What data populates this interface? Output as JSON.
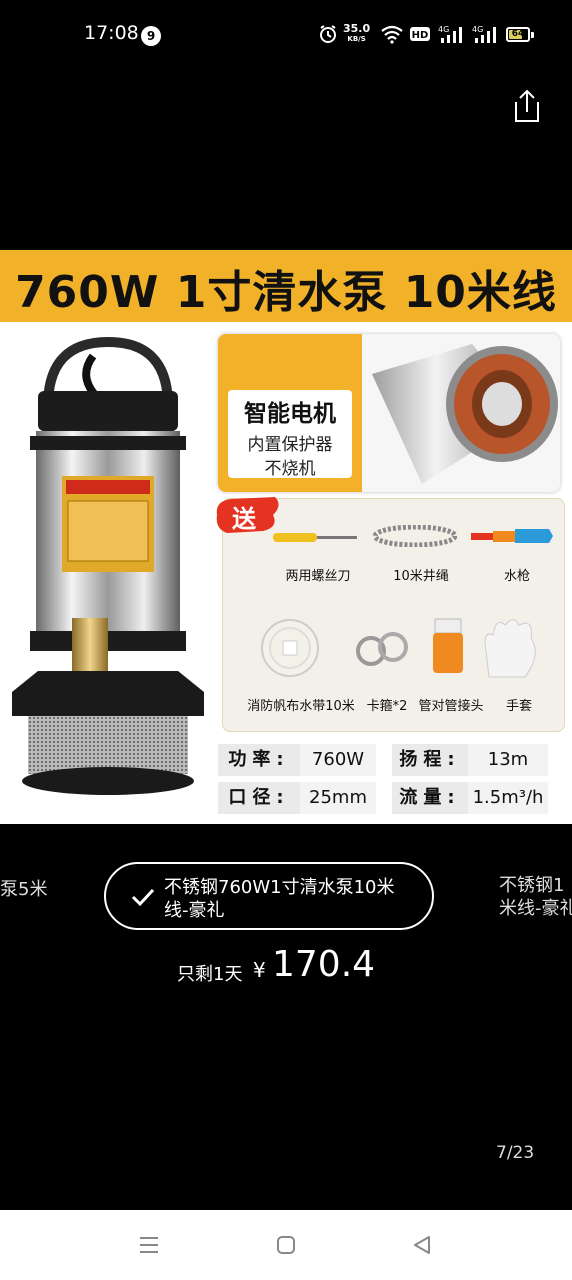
{
  "status_bar": {
    "time": "17:08",
    "notification_count": "9",
    "net_speed_value": "35.0",
    "net_speed_unit": "KB/S",
    "battery_level": "64",
    "icons": [
      "alarm-icon",
      "wifi-icon",
      "hd-icon",
      "signal-4g-icon",
      "signal-4g-icon",
      "battery-icon"
    ]
  },
  "header": {
    "share_icon": "share-icon"
  },
  "product_image": {
    "banner": "760W 1寸清水泵 10米线",
    "motor_feature": {
      "title": "智能电机",
      "line1": "内置保护器",
      "line2": "不烧机"
    },
    "gift_badge": "送",
    "gifts": [
      "两用螺丝刀",
      "10米井绳",
      "水枪",
      "消防帆布水带10米",
      "卡箍*2",
      "管对管接头",
      "手套"
    ],
    "specs": [
      {
        "key": "功率:",
        "value": "760W"
      },
      {
        "key": "扬程:",
        "value": "13m"
      },
      {
        "key": "口径:",
        "value": "25mm"
      },
      {
        "key": "流量:",
        "value": "1.5m³/h"
      }
    ]
  },
  "variants": {
    "prev_partial": "泵5米",
    "selected": "不锈钢760W1寸清水泵10米线-豪礼",
    "next_partial_line1": "不锈钢1",
    "next_partial_line2": "米线-豪礼"
  },
  "price": {
    "prefix": "只剩1天",
    "currency": "¥",
    "value": "170.4"
  },
  "pager": {
    "counter": "7/23"
  },
  "nav_bar": {
    "icons": [
      "menu-icon",
      "home-icon",
      "back-icon"
    ]
  },
  "colors": {
    "banner": "#f1b22a",
    "background": "#000000",
    "gift_badge": "#e53322"
  }
}
